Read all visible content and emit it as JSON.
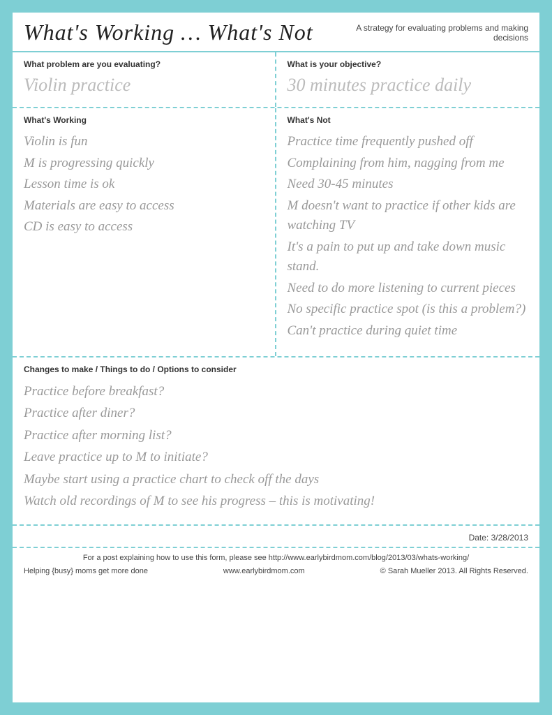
{
  "header": {
    "title": "What's Working … What's Not",
    "subtitle": "A strategy for evaluating problems and making decisions"
  },
  "problem_section": {
    "label": "What problem are you evaluating?",
    "value": "Violin practice"
  },
  "objective_section": {
    "label": "What is your objective?",
    "value": "30 minutes practice daily"
  },
  "working_section": {
    "label": "What's Working",
    "items": [
      "Violin is fun",
      "M is progressing quickly",
      "Lesson time is ok",
      "Materials are easy to access",
      "CD is easy to access"
    ]
  },
  "not_working_section": {
    "label": "What's Not",
    "items": [
      "Practice time frequently pushed off",
      "Complaining from him, nagging from me",
      "Need 30-45 minutes",
      "M doesn't want to practice if other kids are watching TV",
      "It's a pain to put up and take down music stand.",
      "Need to do more listening to current pieces",
      "No specific practice spot (is this a problem?)",
      "Can't practice during quiet time"
    ]
  },
  "changes_section": {
    "label": "Changes to make / Things to do / Options to consider",
    "items": [
      "Practice before breakfast?",
      "Practice after diner?",
      "Practice after morning list?",
      "Leave practice up to M to initiate?",
      "Maybe start using a practice chart to check off the days",
      "Watch old recordings of M to see his progress – this is motivating!"
    ]
  },
  "date": {
    "label": "Date:",
    "value": "3/28/2013"
  },
  "footer": {
    "top_line": "For a post explaining how to use this form, please see http://www.earlybirdmom.com/blog/2013/03/whats-working/",
    "left": "Helping {busy} moms get more done",
    "center": "www.earlybirdmom.com",
    "right": "© Sarah Mueller 2013. All Rights Reserved."
  }
}
